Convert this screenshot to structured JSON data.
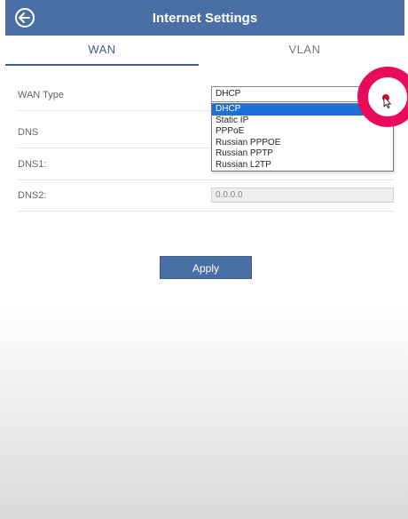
{
  "header": {
    "title": "Internet Settings",
    "back_icon": "back-arrow-circle-icon"
  },
  "tabs": [
    {
      "label": "WAN",
      "active": true
    },
    {
      "label": "VLAN",
      "active": false
    }
  ],
  "form": {
    "wan_type_label": "WAN Type",
    "wan_type_selected": "DHCP",
    "wan_type_options": [
      "DHCP",
      "Static IP",
      "PPPoE",
      "Russian PPPOE",
      "Russian PPTP",
      "Russian L2TP"
    ],
    "dns_label": "DNS",
    "dns1_label": "DNS1:",
    "dns2_label": "DNS2:",
    "dns2_value": "0.0.0.0"
  },
  "apply_label": "Apply",
  "colors": {
    "header_bg": "#4a6fa5",
    "accent": "#3b5f93",
    "selected_option": "#1e6fd9",
    "click_highlight": "#ea0a5a"
  }
}
